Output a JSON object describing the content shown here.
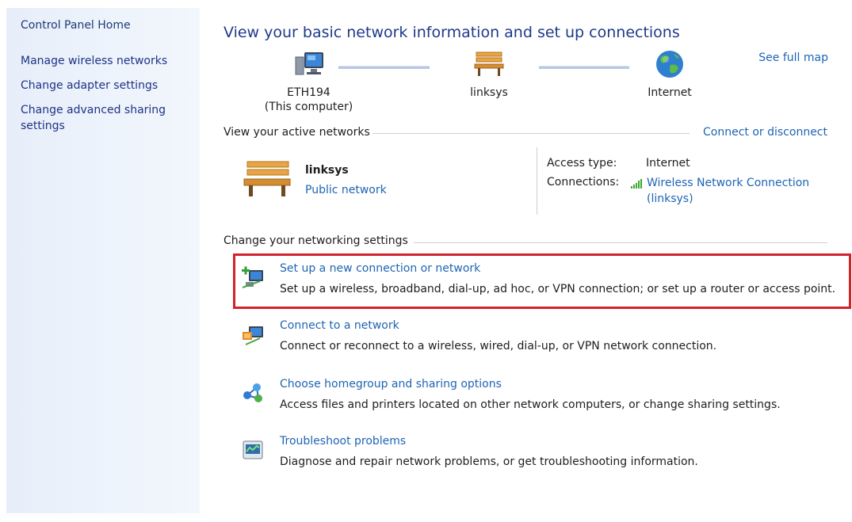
{
  "sidebar": {
    "home": "Control Panel Home",
    "items": [
      {
        "label": "Manage wireless networks"
      },
      {
        "label": "Change adapter settings"
      },
      {
        "label": "Change advanced sharing settings"
      }
    ]
  },
  "header": {
    "title": "View your basic network information and set up connections",
    "see_full_map": "See full map"
  },
  "map": {
    "computer_name": "ETH194",
    "computer_caption": "(This computer)",
    "network_name": "linksys",
    "internet": "Internet"
  },
  "active": {
    "heading": "View your active networks",
    "connect_link": "Connect or disconnect",
    "network_name": "linksys",
    "network_category": "Public network",
    "access_type_label": "Access type:",
    "access_type_value": "Internet",
    "connections_label": "Connections:",
    "connection_name_line1": "Wireless Network Connection",
    "connection_name_line2": "(linksys)"
  },
  "settings": {
    "heading": "Change your networking settings",
    "tasks": [
      {
        "icon": "new-connection-icon",
        "link": "Set up a new connection or network",
        "desc": "Set up a wireless, broadband, dial-up, ad hoc, or VPN connection; or set up a router or access point."
      },
      {
        "icon": "connect-network-icon",
        "link": "Connect to a network",
        "desc": "Connect or reconnect to a wireless, wired, dial-up, or VPN network connection."
      },
      {
        "icon": "homegroup-icon",
        "link": "Choose homegroup and sharing options",
        "desc": "Access files and printers located on other network computers, or change sharing settings."
      },
      {
        "icon": "troubleshoot-icon",
        "link": "Troubleshoot problems",
        "desc": "Diagnose and repair network problems, or get troubleshooting information."
      }
    ]
  },
  "colors": {
    "link": "#1e64b4",
    "highlight": "#d2232a",
    "sidebar": "#eef4fc"
  }
}
